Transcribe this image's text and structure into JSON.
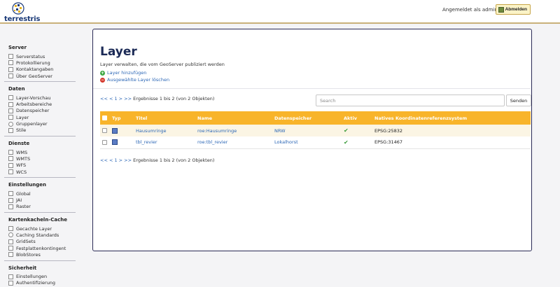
{
  "header": {
    "logo_text": "terrestris",
    "logged_in": "Angemeldet als admin.",
    "logout_label": "Abmelden"
  },
  "sidebar": {
    "sections": [
      {
        "title": "Server",
        "items": [
          {
            "label": "Serverstatus",
            "icon": "status-icon"
          },
          {
            "label": "Protokollierung",
            "icon": "log-icon"
          },
          {
            "label": "Kontaktangaben",
            "icon": "contact-icon"
          },
          {
            "label": "Über GeoServer",
            "icon": "about-icon"
          }
        ]
      },
      {
        "title": "Daten",
        "items": [
          {
            "label": "Layer-Vorschau",
            "icon": "preview-icon"
          },
          {
            "label": "Arbeitsbereiche",
            "icon": "workspace-icon"
          },
          {
            "label": "Datenspeicher",
            "icon": "store-icon"
          },
          {
            "label": "Layer",
            "icon": "layer-icon"
          },
          {
            "label": "Gruppenlayer",
            "icon": "group-icon"
          },
          {
            "label": "Stile",
            "icon": "style-icon"
          }
        ]
      },
      {
        "title": "Dienste",
        "items": [
          {
            "label": "WMS",
            "icon": "wms-icon"
          },
          {
            "label": "WMTS",
            "icon": "wmts-icon"
          },
          {
            "label": "WFS",
            "icon": "wfs-icon"
          },
          {
            "label": "WCS",
            "icon": "wcs-icon"
          }
        ]
      },
      {
        "title": "Einstellungen",
        "items": [
          {
            "label": "Global",
            "icon": "global-icon"
          },
          {
            "label": "JAI",
            "icon": "jai-icon"
          },
          {
            "label": "Raster",
            "icon": "raster-icon"
          }
        ]
      },
      {
        "title": "Kartenkacheln-Cache",
        "items": [
          {
            "label": "Gecachte Layer",
            "icon": "cached-layer-icon"
          },
          {
            "label": "Caching Standards",
            "icon": "caching-standards-icon"
          },
          {
            "label": "GridSets",
            "icon": "gridset-icon"
          },
          {
            "label": "Festplattenkontingent",
            "icon": "disk-quota-icon"
          },
          {
            "label": "BlobStores",
            "icon": "blobstore-icon"
          }
        ]
      },
      {
        "title": "Sicherheit",
        "items": [
          {
            "label": "Einstellungen",
            "icon": "key-icon"
          },
          {
            "label": "Authentifizierung",
            "icon": "auth-icon"
          }
        ]
      }
    ]
  },
  "main": {
    "title": "Layer",
    "description": "Layer verwalten, die vom GeoServer publiziert werden",
    "add_layer": "Layer hinzufügen",
    "remove_layers": "Ausgewählte Layer löschen",
    "pager_links": "<< < 1 > >>",
    "pager_text": "Ergebnisse 1 bis 2 (von 2 Objekten)",
    "search_placeholder": "Search",
    "send_label": "Senden",
    "table": {
      "headers": [
        "Typ",
        "Titel",
        "Name",
        "Datenspeicher",
        "Aktiv",
        "Natives Koordinatenreferenzsystem"
      ],
      "rows": [
        {
          "title": "Hausumringe",
          "name": "roe:Hausumringe",
          "store": "NRW",
          "active": "✔",
          "crs": "EPSG:25832"
        },
        {
          "title": "tbl_revier",
          "name": "roe:tbl_revier",
          "store": "Lokalhorst",
          "active": "✔",
          "crs": "EPSG:31467"
        }
      ]
    }
  },
  "colors": {
    "accent": "#f8b42a",
    "link": "#2c67b6",
    "title": "#1b2a56",
    "panel_border": "#2a2a55"
  }
}
